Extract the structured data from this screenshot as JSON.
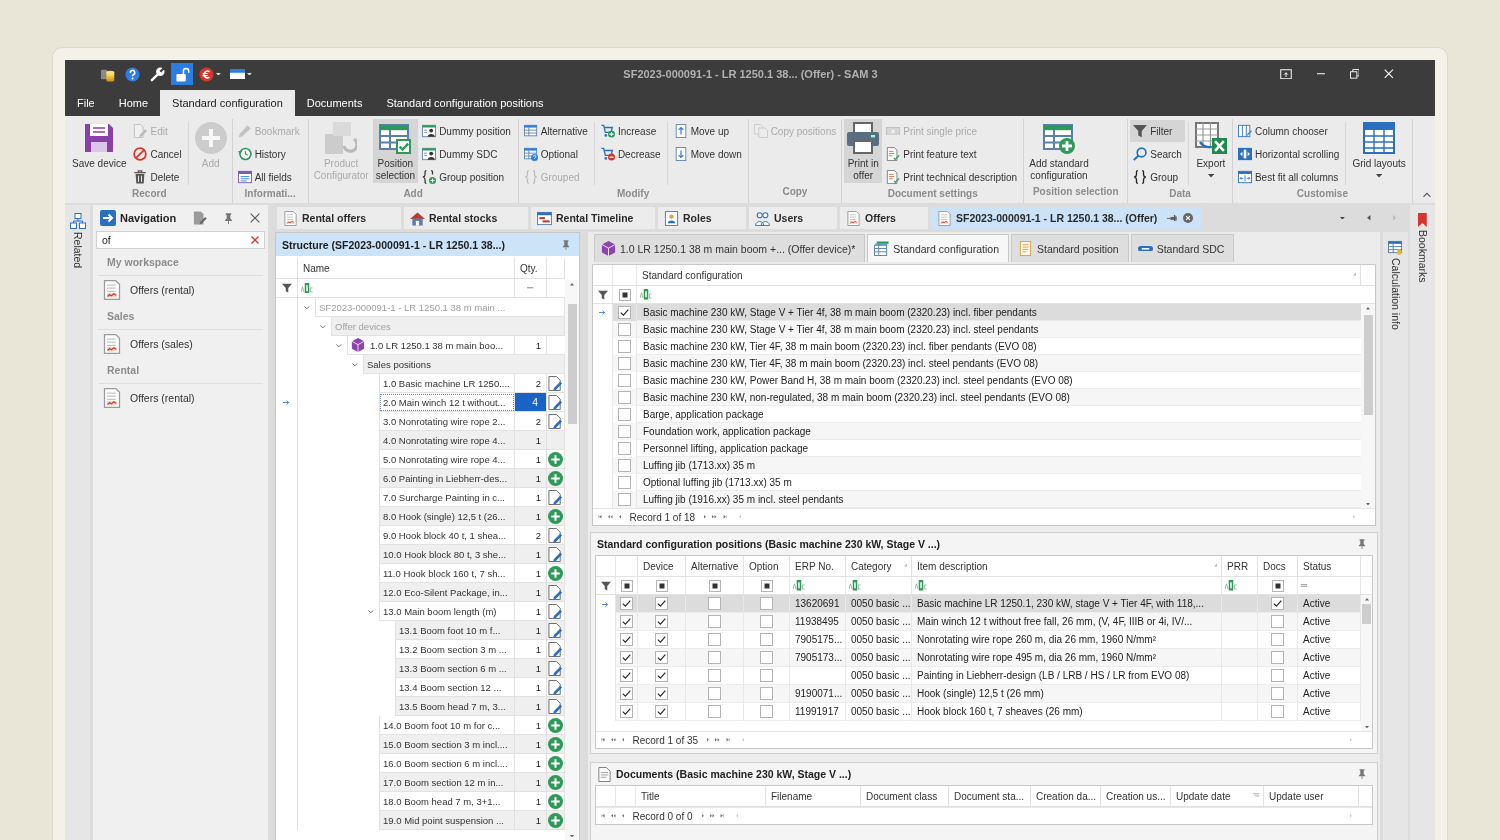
{
  "window": {
    "title": "SF2023-000091-1 - LR 1250.1 38... (Offer) **- SAM 3**"
  },
  "quick_access": [
    {
      "pressed": false,
      "dropdown": false
    },
    {
      "pressed": false,
      "dropdown": false
    },
    {
      "pressed": false,
      "dropdown": false
    },
    {
      "pressed": true,
      "dropdown": false
    },
    {
      "pressed": false,
      "dropdown": true
    },
    {
      "pressed": false,
      "dropdown": true
    }
  ],
  "menu_tabs": [
    {
      "label": "File",
      "selected": false
    },
    {
      "label": "Home",
      "selected": false
    },
    {
      "label": "Standard configuration",
      "selected": true
    },
    {
      "label": "Documents",
      "selected": false
    },
    {
      "label": "Standard configuration positions",
      "selected": false
    }
  ],
  "ribbon": {
    "groups": [
      {
        "label": "Record",
        "items": [
          {
            "kind": "large",
            "label": "Save device",
            "disabled": false,
            "pressed": false
          },
          {
            "kind": "stack",
            "buttons": [
              {
                "label": "Edit",
                "disabled": true,
                "pressed": false
              },
              {
                "label": "Cancel",
                "disabled": false,
                "pressed": false
              },
              {
                "label": "Delete",
                "disabled": false,
                "pressed": false
              }
            ]
          },
          {
            "kind": "large",
            "label": "Add",
            "disabled": true,
            "pressed": false
          }
        ]
      },
      {
        "label": "Informati...",
        "items": [
          {
            "kind": "stack",
            "buttons": [
              {
                "label": "Bookmark",
                "disabled": true,
                "pressed": false
              },
              {
                "label": "History",
                "disabled": false,
                "pressed": false
              },
              {
                "label": "All fields",
                "disabled": false,
                "pressed": false
              }
            ]
          }
        ]
      },
      {
        "label": "Add",
        "items": [
          {
            "kind": "large",
            "label": "Product\nConfigurator",
            "disabled": true,
            "pressed": false
          },
          {
            "kind": "large",
            "label": "Position\nselection",
            "disabled": false,
            "pressed": true
          },
          {
            "kind": "stack",
            "buttons": [
              {
                "label": "Dummy position",
                "disabled": false,
                "pressed": false
              },
              {
                "label": "Dummy SDC",
                "disabled": false,
                "pressed": false
              },
              {
                "label": "Group position",
                "disabled": false,
                "pressed": false
              }
            ]
          }
        ]
      },
      {
        "label": "Modify",
        "items": [
          {
            "kind": "stack",
            "buttons": [
              {
                "label": "Alternative",
                "disabled": false,
                "pressed": false
              },
              {
                "label": "Optional",
                "disabled": false,
                "pressed": false
              },
              {
                "label": "Grouped",
                "disabled": true,
                "pressed": false
              }
            ]
          },
          {
            "kind": "stack",
            "buttons": [
              {
                "label": "Increase",
                "disabled": false,
                "pressed": false
              },
              {
                "label": "Decrease",
                "disabled": false,
                "pressed": false
              }
            ]
          },
          {
            "kind": "stack",
            "buttons": [
              {
                "label": "Move up",
                "disabled": false,
                "pressed": false
              },
              {
                "label": "Move down",
                "disabled": false,
                "pressed": false
              }
            ]
          }
        ]
      },
      {
        "label": "Copy",
        "items": [
          {
            "kind": "stack",
            "buttons": [
              {
                "label": "Copy positions",
                "disabled": true,
                "pressed": false
              }
            ]
          }
        ]
      },
      {
        "label": "Document settings",
        "items": [
          {
            "kind": "large",
            "label": "Print in\noffer",
            "disabled": false,
            "pressed": true
          },
          {
            "kind": "stack",
            "buttons": [
              {
                "label": "Print single price",
                "disabled": true,
                "pressed": false
              },
              {
                "label": "Print feature text",
                "disabled": false,
                "pressed": false
              },
              {
                "label": "Print technical description",
                "disabled": false,
                "pressed": false
              }
            ]
          }
        ]
      },
      {
        "label": "Position selection",
        "items": [
          {
            "kind": "large",
            "label": "Add standard\nconfiguration",
            "disabled": false,
            "pressed": false
          }
        ]
      },
      {
        "label": "Data",
        "items": [
          {
            "kind": "stack",
            "buttons": [
              {
                "label": "Filter",
                "disabled": false,
                "pressed": true
              },
              {
                "label": "Search",
                "disabled": false,
                "pressed": false
              },
              {
                "label": "Group",
                "disabled": false,
                "pressed": false
              }
            ]
          },
          {
            "kind": "large",
            "label": "Export",
            "disabled": false,
            "pressed": false,
            "dropdown": true
          }
        ]
      },
      {
        "label": "Customise",
        "items": [
          {
            "kind": "stack",
            "buttons": [
              {
                "label": "Column chooser",
                "disabled": false,
                "pressed": false
              },
              {
                "label": "Horizontal scrolling",
                "disabled": false,
                "pressed": false
              },
              {
                "label": "Best fit all columns",
                "disabled": false,
                "pressed": false
              }
            ]
          },
          {
            "kind": "large",
            "label": "Grid layouts",
            "disabled": false,
            "pressed": false,
            "dropdown": true
          }
        ]
      }
    ]
  },
  "related_panel": {
    "label": "Related"
  },
  "navigation": {
    "title": "Navigation",
    "search": {
      "value": "of"
    },
    "sections": [
      {
        "label": "My workspace",
        "items": [
          {
            "label": "Offers (rental)",
            "selected": false
          }
        ]
      },
      {
        "label": "Sales",
        "items": [
          {
            "label": "Offers (sales)",
            "selected": false
          }
        ]
      },
      {
        "label": "Rental",
        "items": [
          {
            "label": "Offers (rental)",
            "selected": false
          }
        ]
      }
    ]
  },
  "doc_tabs": [
    {
      "label": "Rental offers",
      "selected": false
    },
    {
      "label": "Rental stocks",
      "selected": false
    },
    {
      "label": "Rental Timeline",
      "selected": false
    },
    {
      "label": "Roles",
      "selected": false
    },
    {
      "label": "Users",
      "selected": false
    },
    {
      "label": "Offers",
      "selected": false
    },
    {
      "label": "SF2023-000091-1 - LR 1250.1 38... (Offer)",
      "selected": true
    }
  ],
  "structure": {
    "title": "Structure (SF2023-000091-1 - LR 1250.1 38...)",
    "columns": [
      "Name",
      "Qty."
    ],
    "tree": [
      {
        "label": "SF2023-000091-1 - LR 1250.1 38 m main ...",
        "kind": "folder",
        "disabled": true,
        "selected": false,
        "expanded": true,
        "children": [
          {
            "label": "Offer devices",
            "kind": "folder",
            "disabled": true,
            "selected": false,
            "expanded": true,
            "children": [
              {
                "label": "1.0 LR 1250.1 38 m main boo...",
                "qty": "1",
                "kind": "device",
                "disabled": false,
                "selected": false,
                "expanded": true,
                "children": [
                  {
                    "label": "Sales positions",
                    "kind": "folder",
                    "disabled": false,
                    "selected": false,
                    "expanded": true,
                    "children": [
                      {
                        "label": "1.0 Basic machine LR 1250....",
                        "qty": "2",
                        "kind": "document",
                        "disabled": false,
                        "selected": false
                      },
                      {
                        "label": "2.0 Main winch 12 t without...",
                        "qty": "4",
                        "kind": "document",
                        "disabled": false,
                        "selected": true
                      },
                      {
                        "label": "3.0 Nonrotating wire rope 2...",
                        "qty": "2",
                        "kind": "document",
                        "disabled": false,
                        "selected": false
                      },
                      {
                        "label": "4.0 Nonrotating wire rope 4...",
                        "qty": "1",
                        "kind": "position",
                        "disabled": false,
                        "selected": false
                      },
                      {
                        "label": "5.0 Nonrotating wire rope 4...",
                        "qty": "1",
                        "kind": "add",
                        "disabled": false,
                        "selected": false
                      },
                      {
                        "label": "6.0 Painting in Liebherr-des...",
                        "qty": "1",
                        "kind": "add",
                        "disabled": false,
                        "selected": false
                      },
                      {
                        "label": "7.0 Surcharge Painting in c...",
                        "qty": "1",
                        "kind": "document",
                        "disabled": false,
                        "selected": false
                      },
                      {
                        "label": "8.0 Hook (single) 12,5 t (26...",
                        "qty": "1",
                        "kind": "add",
                        "disabled": false,
                        "selected": false
                      },
                      {
                        "label": "9.0 Hook block 40 t, 1 shea...",
                        "qty": "2",
                        "kind": "document",
                        "disabled": false,
                        "selected": false
                      },
                      {
                        "label": "10.0 Hook block 80 t, 3 she...",
                        "qty": "1",
                        "kind": "document",
                        "disabled": false,
                        "selected": false
                      },
                      {
                        "label": "11.0 Hook block 160 t, 7 sh...",
                        "qty": "1",
                        "kind": "add",
                        "disabled": false,
                        "selected": false
                      },
                      {
                        "label": "12.0 Eco-Silent Package, in...",
                        "qty": "1",
                        "kind": "document",
                        "disabled": false,
                        "selected": false
                      },
                      {
                        "label": "13.0 Main boom length (m)",
                        "qty": "1",
                        "kind": "document",
                        "disabled": false,
                        "selected": false,
                        "expanded": true,
                        "children": [
                          {
                            "label": "13.1 Boom foot 10 m f...",
                            "qty": "1",
                            "kind": "document",
                            "disabled": false,
                            "selected": false
                          },
                          {
                            "label": "13.2 Boom section 3 m ...",
                            "qty": "1",
                            "kind": "document",
                            "disabled": false,
                            "selected": false
                          },
                          {
                            "label": "13.3 Boom section 6 m ...",
                            "qty": "1",
                            "kind": "document",
                            "disabled": false,
                            "selected": false
                          },
                          {
                            "label": "13.4 Boom section 12 ...",
                            "qty": "1",
                            "kind": "document",
                            "disabled": false,
                            "selected": false
                          },
                          {
                            "label": "13.5 Boom head 7 m, 3...",
                            "qty": "1",
                            "kind": "document",
                            "disabled": false,
                            "selected": false
                          }
                        ]
                      },
                      {
                        "label": "14.0 Boom foot 10 m for c...",
                        "qty": "1",
                        "kind": "add",
                        "disabled": false,
                        "selected": false
                      },
                      {
                        "label": "15.0 Boom section 3 m incl....",
                        "qty": "1",
                        "kind": "add",
                        "disabled": false,
                        "selected": false
                      },
                      {
                        "label": "16.0 Boom section 6 m incl....",
                        "qty": "1",
                        "kind": "add",
                        "disabled": false,
                        "selected": false
                      },
                      {
                        "label": "17.0 Boom section 12 m in...",
                        "qty": "1",
                        "kind": "add",
                        "disabled": false,
                        "selected": false
                      },
                      {
                        "label": "18.0 Boom head 7 m, 3+1...",
                        "qty": "1",
                        "kind": "add",
                        "disabled": false,
                        "selected": false
                      },
                      {
                        "label": "19.0 Mid point suspension ...",
                        "qty": "1",
                        "kind": "add",
                        "disabled": false,
                        "selected": false
                      }
                    ]
                  }
                ]
              }
            ]
          }
        ]
      }
    ]
  },
  "device_tabs": [
    {
      "label": "1.0 LR 1250.1 38 m main boom +... (Offer device)*",
      "selected": false
    },
    {
      "label": "Standard configuration",
      "selected": true
    },
    {
      "label": "Standard position",
      "selected": false
    },
    {
      "label": "Standard SDC",
      "selected": false
    }
  ],
  "standard_configuration": {
    "check_filter_indeterminate": true,
    "column": {
      "label": "Standard configuration",
      "sorted": true
    },
    "rows": [
      {
        "label": "Basic machine 230 kW, Stage V + Tier 4f, 38 m main boom (2320.23) incl. fiber pendants",
        "checked": true,
        "selected": true
      },
      {
        "label": "Basic machine 230 kW, Stage V + Tier 4f, 38 m main boom (2320.23) incl. steel pendants",
        "checked": false,
        "selected": false
      },
      {
        "label": "Basic machine 230 kW, Tier 4F, 38 m main boom (2320.23) incl. fiber pendants (EVO 08)",
        "checked": false,
        "selected": false
      },
      {
        "label": "Basic machine 230 kW, Tier 4F, 38 m main boom (2320.23) incl. steel pendants (EVO 08)",
        "checked": false,
        "selected": false
      },
      {
        "label": "Basic machine 230 kW, Power Band H, 38 m main boom (2320.23) incl. steel pendants (EVO 08)",
        "checked": false,
        "selected": false
      },
      {
        "label": "Basic machine 230 kW, non-regulated, 38 m main boom (2320.23) incl. steel pendants (EVO 08)",
        "checked": false,
        "selected": false
      },
      {
        "label": "Barge, application package",
        "checked": false,
        "selected": false
      },
      {
        "label": "Foundation work, application package",
        "checked": false,
        "selected": false
      },
      {
        "label": "Personnel lifting, application package",
        "checked": false,
        "selected": false
      },
      {
        "label": "Luffing jib (1713.xx) 35 m",
        "checked": false,
        "selected": false
      },
      {
        "label": "Optional luffing jib (1713.xx) 35 m",
        "checked": false,
        "selected": false
      },
      {
        "label": "Luffing jib (1916.xx) 35 m incl. steel pendants",
        "checked": false,
        "selected": false
      }
    ],
    "record": "Record 1 of 18"
  },
  "positions": {
    "title": "Standard configuration positions (Basic machine 230 kW, Stage V ...)",
    "columns": [
      {
        "kind": "check",
        "filter_indeterminate": true
      },
      {
        "label": "Device",
        "kind": "check",
        "filter_indeterminate": true,
        "sorted": false
      },
      {
        "label": "Alternative",
        "kind": "check",
        "filter_indeterminate": true,
        "sorted": false
      },
      {
        "label": "Option",
        "kind": "check",
        "filter_indeterminate": true,
        "sorted": false
      },
      {
        "label": "ERP No.",
        "kind": "text",
        "sorted": false
      },
      {
        "label": "Category",
        "kind": "text",
        "sorted": true
      },
      {
        "label": "Item description",
        "kind": "text",
        "sorted": true
      },
      {
        "label": "PRR",
        "kind": "text",
        "sorted": false
      },
      {
        "label": "Docs",
        "kind": "check",
        "filter_indeterminate": true,
        "sorted": false
      },
      {
        "label": "Status",
        "kind": "choice",
        "sorted": false
      }
    ],
    "rows": [
      {
        "selected": true,
        "checked": true,
        "device": true,
        "alternative": false,
        "option": false,
        "erp_no": "13620691",
        "category": "0050 basic ...",
        "item_description": "Basic machine LR 1250.1, 230 kW, stage V + Tier 4F, with 118,...",
        "docs": true,
        "status": "Active"
      },
      {
        "selected": false,
        "checked": true,
        "device": true,
        "alternative": false,
        "option": false,
        "erp_no": "11938495",
        "category": "0050 basic ...",
        "item_description": "Main winch 12 t without free fall, 26 mm, (V, 4F, IIIB or 4i, IV/...",
        "docs": false,
        "status": "Active"
      },
      {
        "selected": false,
        "checked": true,
        "device": true,
        "alternative": false,
        "option": false,
        "erp_no": "7905175...",
        "category": "0050 basic ...",
        "item_description": "Nonrotating wire rope 260 m, dia 26 mm, 1960 N/mm²",
        "docs": false,
        "status": "Active"
      },
      {
        "selected": false,
        "checked": true,
        "device": true,
        "alternative": false,
        "option": false,
        "erp_no": "7905173...",
        "category": "0050 basic ...",
        "item_description": "Nonrotating wire rope 495 m, dia 26 mm, 1960 N/mm²",
        "docs": false,
        "status": "Active"
      },
      {
        "selected": false,
        "checked": true,
        "device": true,
        "alternative": false,
        "option": false,
        "category": "0050 basic ...",
        "item_description": "Painting in Liebherr-design (LB / LRB / HS / LR from EVO 08)",
        "docs": false,
        "status": "Active"
      },
      {
        "selected": false,
        "checked": true,
        "device": true,
        "alternative": false,
        "option": false,
        "erp_no": "9190071...",
        "category": "0050 basic ...",
        "item_description": "Hook (single) 12,5 t (26 mm)",
        "docs": false,
        "status": "Active"
      },
      {
        "selected": false,
        "checked": true,
        "device": true,
        "alternative": false,
        "option": false,
        "erp_no": "11991917",
        "category": "0050 basic ...",
        "item_description": "Hook block 160 t, 7 sheaves (26 mm)",
        "docs": false,
        "status": "Active"
      }
    ],
    "record": "Record 1 of 35"
  },
  "documents": {
    "title": "Documents (Basic machine 230 kW, Stage V ...)",
    "columns": [
      {
        "label": "Title",
        "sorted": false
      },
      {
        "label": "Filename",
        "sorted": false
      },
      {
        "label": "Document class",
        "sorted": false
      },
      {
        "label": "Document sta...",
        "sorted": false
      },
      {
        "label": "Creation da...",
        "sorted": false
      },
      {
        "label": "Creation us...",
        "sorted": false
      },
      {
        "label": "Update date",
        "sorted": true
      },
      {
        "label": "Update user",
        "sorted": false
      }
    ],
    "record": "Record 0 of 0"
  },
  "side_panels": [
    {
      "label": "Calculation info"
    },
    {
      "label": "Bookmarks"
    }
  ]
}
